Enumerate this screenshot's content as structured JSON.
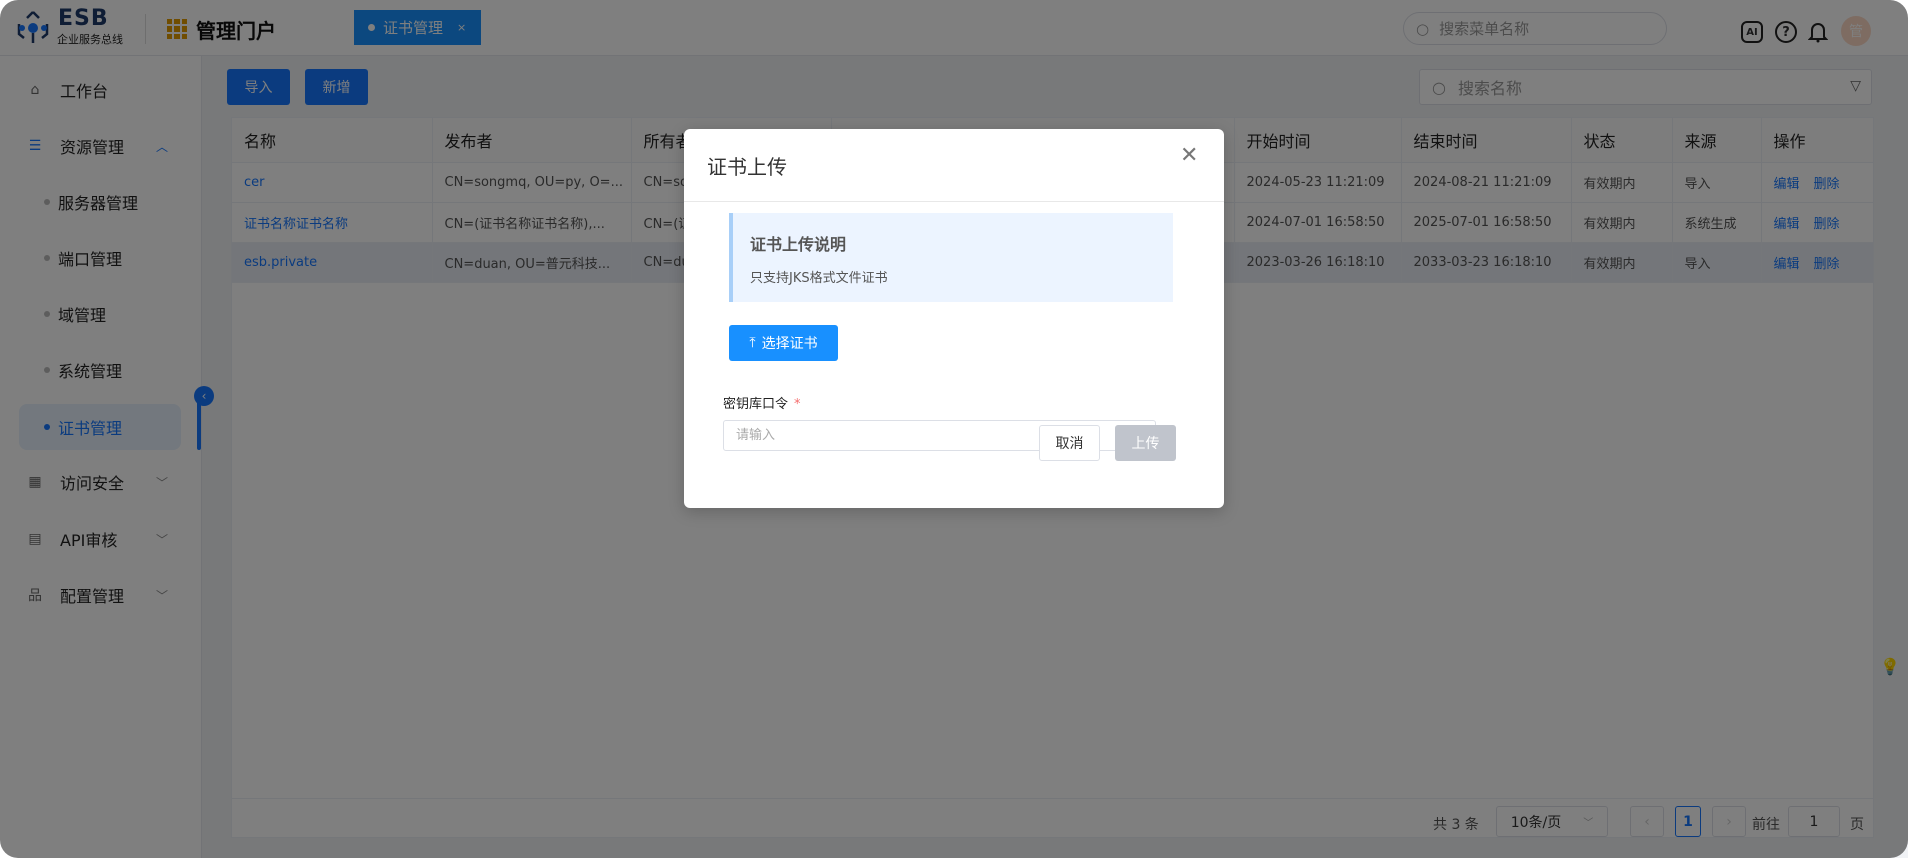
{
  "header": {
    "logo": "ESB",
    "logo_sub": "企业服务总线",
    "portal": "管理门户",
    "tab": "证书管理",
    "tab_close": "×",
    "search_placeholder": "搜索菜单名称",
    "ai_icon": "AI",
    "avatar": "管"
  },
  "sidebar": {
    "items": [
      {
        "label": "工作台",
        "icon": "home-icon"
      },
      {
        "label": "资源管理",
        "icon": "server-icon",
        "expanded": true
      },
      {
        "label": "访问安全",
        "icon": "apps-icon"
      },
      {
        "label": "API审核",
        "icon": "audit-icon"
      },
      {
        "label": "配置管理",
        "icon": "org-icon"
      }
    ],
    "sub_items": [
      "服务器管理",
      "端口管理",
      "域管理",
      "系统管理",
      "证书管理"
    ],
    "active": "证书管理"
  },
  "toolbar": {
    "import": "导入",
    "add": "新增",
    "search_placeholder": "搜索名称"
  },
  "table": {
    "columns": [
      "名称",
      "发布者",
      "所有者",
      "",
      "开始时间",
      "结束时间",
      "状态",
      "来源",
      "操作"
    ],
    "rows": [
      {
        "name": "cer",
        "issuer": "CN=songmq, OU=py, O=...",
        "owner": "CN=so",
        "start": "2024-05-23 11:21:09",
        "end": "2024-08-21 11:21:09",
        "status": "有效期内",
        "source": "导入"
      },
      {
        "name": "证书名称证书名称",
        "issuer": "CN=(证书名称证书名称),...",
        "owner": "CN=(证",
        "start": "2024-07-01 16:58:50",
        "end": "2025-07-01 16:58:50",
        "status": "有效期内",
        "source": "系统生成"
      },
      {
        "name": "esb.private",
        "issuer": "CN=duan, OU=普元科技...",
        "owner": "CN=du",
        "start": "2023-03-26 16:18:10",
        "end": "2033-03-23 16:18:10",
        "status": "有效期内",
        "source": "导入"
      }
    ],
    "edit": "编辑",
    "delete": "删除"
  },
  "pagination": {
    "total": "共 3 条",
    "page_size": "10条/页",
    "current": "1",
    "goto": "前往",
    "goto_value": "1",
    "page_unit": "页"
  },
  "modal": {
    "title": "证书上传",
    "info_title": "证书上传说明",
    "info_text": "只支持JKS格式文件证书",
    "choose": "选择证书",
    "label": "密钥库口令",
    "required": "*",
    "placeholder": "请输入",
    "cancel": "取消",
    "upload": "上传"
  },
  "colors": {
    "primary": "#1677ff",
    "required": "#f56c6c",
    "disabled": "#c0c4cc"
  }
}
